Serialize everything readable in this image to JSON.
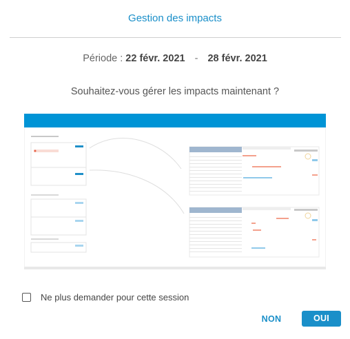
{
  "dialog": {
    "title": "Gestion des impacts",
    "period_label": "Période :",
    "period_start": "22 févr. 2021",
    "period_separator": "-",
    "period_end": "28 févr. 2021",
    "question": "Souhaitez-vous gérer les impacts maintenant ?",
    "checkbox_label": "Ne plus demander pour cette session",
    "checkbox_checked": false,
    "no_label": "NON",
    "yes_label": "OUI"
  },
  "colors": {
    "accent": "#1a8fc9",
    "separator": "#cfcfcf"
  }
}
